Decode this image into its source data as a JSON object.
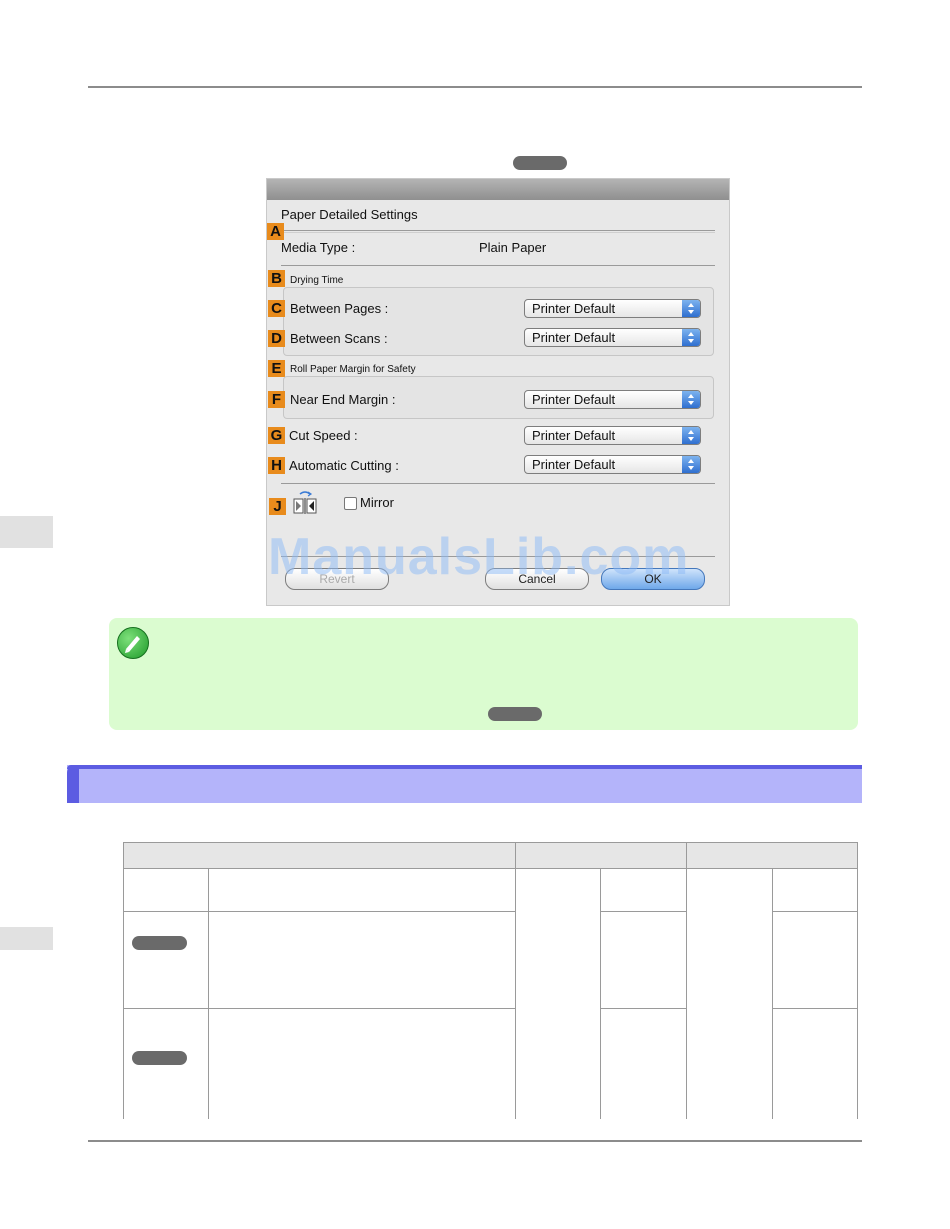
{
  "dialog": {
    "heading": "Paper Detailed Settings",
    "markers": [
      "A",
      "B",
      "C",
      "D",
      "E",
      "F",
      "G",
      "H",
      "J"
    ],
    "media_type": {
      "label": "Media Type :",
      "value": "Plain Paper"
    },
    "drying_time": {
      "title": "Drying Time"
    },
    "between_pages": {
      "label": "Between Pages :",
      "value": "Printer Default"
    },
    "between_scans": {
      "label": "Between Scans :",
      "value": "Printer Default"
    },
    "roll_margin": {
      "title": "Roll Paper Margin for Safety"
    },
    "near_end_margin": {
      "label": "Near End Margin :",
      "value": "Printer Default"
    },
    "cut_speed": {
      "label": "Cut Speed :",
      "value": "Printer Default"
    },
    "automatic_cutting": {
      "label": "Automatic Cutting :",
      "value": "Printer Default"
    },
    "mirror": {
      "label": "Mirror",
      "checked": false
    },
    "buttons": {
      "revert": "Revert",
      "cancel": "Cancel",
      "ok": "OK"
    }
  },
  "watermark": "ManualsLib.com",
  "colors": {
    "marker": "#e88b1c",
    "note_bg": "#dbfcd0",
    "section_header": "#b4b4fa",
    "section_accent": "#5c5ce2"
  }
}
